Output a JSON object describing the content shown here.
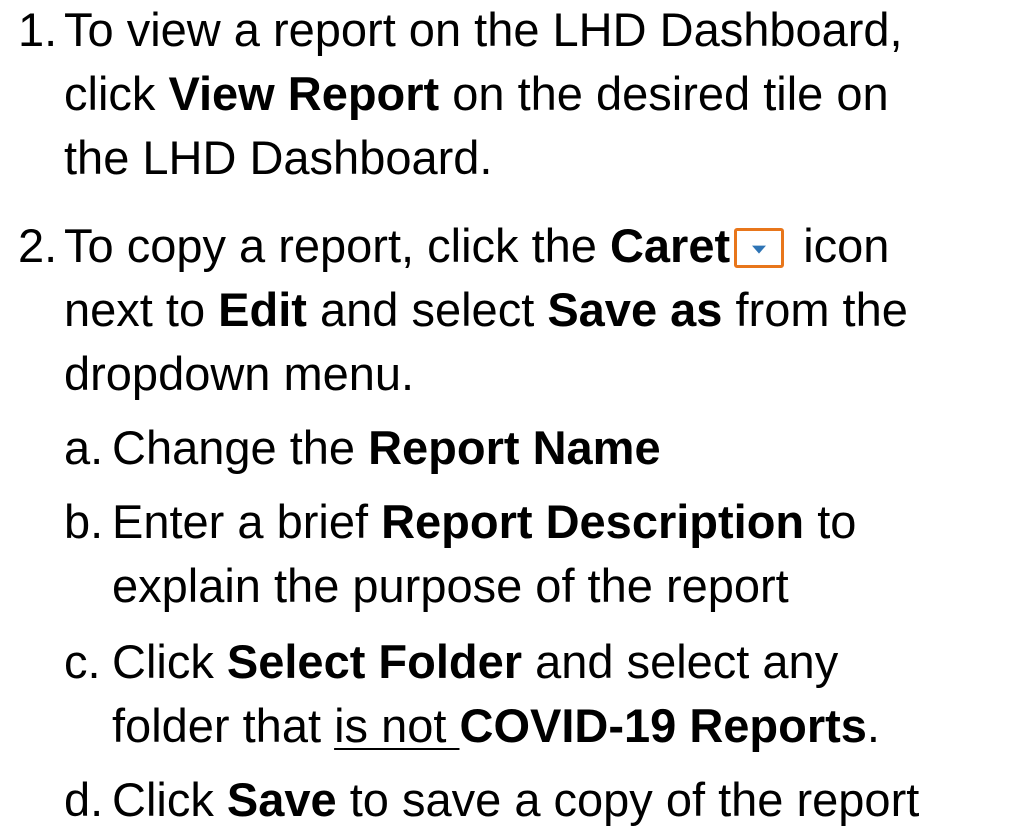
{
  "steps": [
    {
      "number": "1.",
      "lines": [
        {
          "parts": [
            {
              "t": "To view a report on the LHD Dashboard,"
            }
          ]
        },
        {
          "parts": [
            {
              "t": "click "
            },
            {
              "t": "View Report",
              "b": true
            },
            {
              "t": " on the desired tile on"
            }
          ]
        },
        {
          "parts": [
            {
              "t": "the LHD Dashboard."
            }
          ]
        }
      ]
    },
    {
      "number": "2.",
      "line1_a": "To copy a report, click the ",
      "line1_bold": "Caret",
      "caret_icon": "caret-down-icon",
      "line1_b": " icon",
      "line2_a": "next to ",
      "line2_bold1": "Edit",
      "line2_b": " and select ",
      "line2_bold2": "Save as",
      "line2_c": " from the",
      "line3": "dropdown menu."
    }
  ],
  "substeps": {
    "a": {
      "label": "a.",
      "text": "Change the ",
      "bold": "Report Name"
    },
    "b": {
      "label": "b.",
      "text": "Enter a brief ",
      "bold": "Report Description",
      "after": " to",
      "line2": "explain the purpose of the report"
    },
    "c": {
      "label": "c.",
      "text": "Click ",
      "bold": "Select Folder",
      "after": " and select any",
      "line2_a": "folder that ",
      "line2_underline": "is not ",
      "line2_bold": "COVID-19 Reports",
      "line2_end": "."
    },
    "d": {
      "label": "d.",
      "text": "Click ",
      "bold": "Save",
      "after": " to save a copy of the report"
    }
  },
  "colors": {
    "caret_border": "#e8761b",
    "caret_arrow": "#2e74b5"
  }
}
